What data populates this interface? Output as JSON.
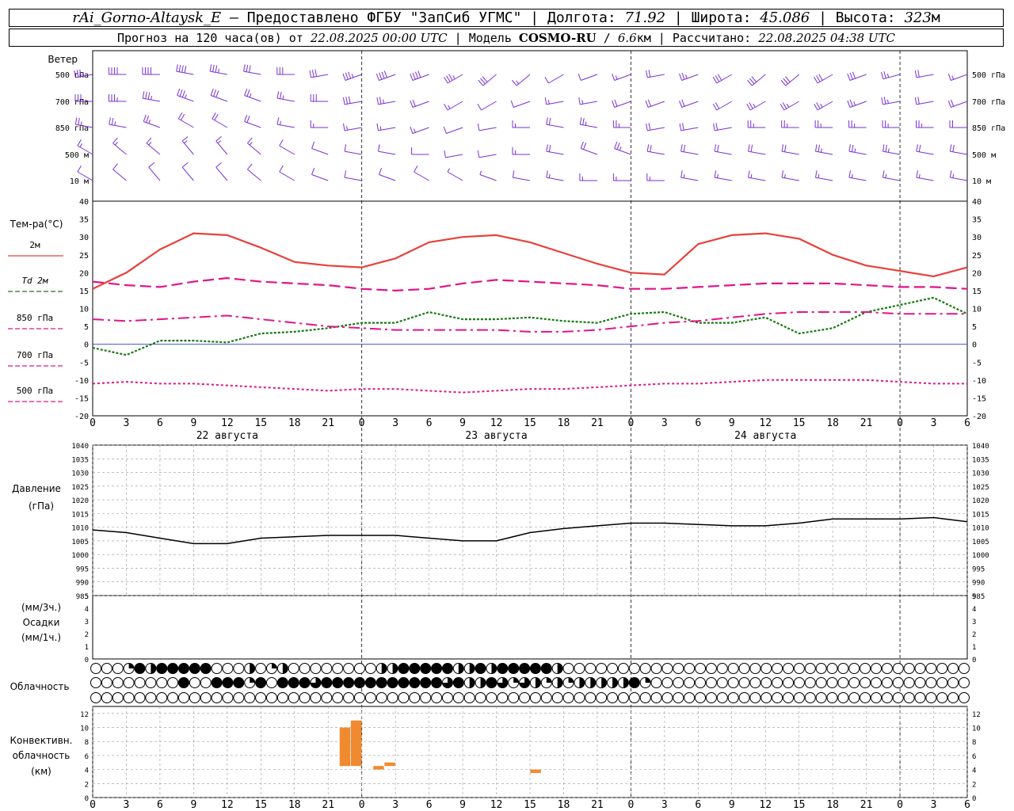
{
  "header": {
    "station": "rAi_Gorno-Altaysk_E",
    "dash": " – ",
    "provider_label": "Предоставлено ФГБУ \"ЗапСиб УГМС\"",
    "lon_label": "Долгота:",
    "lon_value": "71.92",
    "lat_label": "Широта:",
    "lat_value": "45.086",
    "alt_label": "Высота:",
    "alt_value": "323",
    "alt_unit": "м",
    "forecast_label": "Прогноз на 120 часа(ов) от",
    "forecast_time": "22.08.2025 00:00 UTC",
    "model_label": "Модель",
    "model_name": "COSMO-RU",
    "model_res": "6.6",
    "model_res_unit": "км",
    "calc_label": "Рассчитано:",
    "calc_time": "22.08.2025 04:38 UTC"
  },
  "colors": {
    "t2m": "#e8403a",
    "td2m": "#1a7a12",
    "t850": "#e0148a",
    "t700": "#e0148a",
    "t500": "#e0148a",
    "wind": "#7a2fd6",
    "convective": "#f08a30",
    "zero_line": "#2a38d4"
  },
  "panels": {
    "wind": {
      "title": "Ветер",
      "levels": [
        "500 гПа",
        "700 гПа",
        "850 гПа",
        "500 м",
        "10 м"
      ]
    },
    "temp": {
      "title": "Тем-ра(°C)",
      "legend": [
        "2м",
        "Td 2м",
        "850 гПа",
        "700 гПа",
        "500 гПа"
      ]
    },
    "pressure": {
      "title": "Давление",
      "unit": "(гПа)"
    },
    "precip": {
      "unit_top": "(мм/3ч.)",
      "title": "Осадки",
      "unit_bottom": "(мм/1ч.)"
    },
    "cloud": {
      "title": "Облачность"
    },
    "convective": {
      "title_1": "Конвективн.",
      "title_2": "облачность",
      "unit": "(км)"
    }
  },
  "axis": {
    "x_ticks": [
      "0",
      "3",
      "6",
      "9",
      "12",
      "15",
      "18",
      "21",
      "0",
      "3",
      "6",
      "9",
      "12",
      "15",
      "18",
      "21",
      "0",
      "3",
      "6",
      "9",
      "12",
      "15",
      "18",
      "21",
      "0",
      "3",
      "6"
    ],
    "day_labels": [
      "22 августа",
      "23 августа",
      "24 августа"
    ]
  },
  "chart_data": [
    {
      "type": "line",
      "title": "Тем-ра(°C)",
      "x_unit": "hours since 22.08.2025 00:00 UTC",
      "ylim": [
        -20,
        40
      ],
      "yticks": [
        -20,
        -15,
        -10,
        -5,
        0,
        5,
        10,
        15,
        20,
        25,
        30,
        35,
        40
      ],
      "grid": false,
      "series": [
        {
          "name": "2м",
          "x": [
            0,
            3,
            6,
            9,
            12,
            15,
            18,
            21,
            24,
            27,
            30,
            33,
            36,
            39,
            42,
            45,
            48,
            51,
            54,
            57,
            60,
            63,
            66,
            69,
            72,
            75,
            78
          ],
          "values": [
            15.5,
            20,
            26.5,
            31,
            30.5,
            27,
            23,
            22,
            21.5,
            24,
            28.5,
            30,
            30.5,
            28.5,
            25.5,
            22.5,
            20,
            19.5,
            28,
            30.5,
            31,
            29.5,
            25,
            22,
            20.5,
            19,
            21.5
          ]
        },
        {
          "name": "Td 2м",
          "x": [
            0,
            3,
            6,
            9,
            12,
            15,
            18,
            21,
            24,
            27,
            30,
            33,
            36,
            39,
            42,
            45,
            48,
            51,
            54,
            57,
            60,
            63,
            66,
            69,
            72,
            75,
            78
          ],
          "values": [
            -1,
            -3,
            1,
            1,
            0.5,
            3,
            3.5,
            4.5,
            6,
            6,
            9,
            7,
            7,
            7.5,
            6.5,
            6,
            8.5,
            9,
            6,
            6,
            7.5,
            3,
            4.5,
            9,
            11,
            13,
            8.5
          ]
        },
        {
          "name": "850 гПа",
          "x": [
            0,
            3,
            6,
            9,
            12,
            15,
            18,
            21,
            24,
            27,
            30,
            33,
            36,
            39,
            42,
            45,
            48,
            51,
            54,
            57,
            60,
            63,
            66,
            69,
            72,
            75,
            78
          ],
          "values": [
            17.5,
            16.5,
            16,
            17.5,
            18.5,
            17.5,
            17,
            16.5,
            15.5,
            15,
            15.5,
            17,
            18,
            17.5,
            17,
            16.5,
            15.5,
            15.5,
            16,
            16.5,
            17,
            17,
            17,
            16.5,
            16,
            16,
            15.5
          ]
        },
        {
          "name": "700 гПа",
          "x": [
            0,
            3,
            6,
            9,
            12,
            15,
            18,
            21,
            24,
            27,
            30,
            33,
            36,
            39,
            42,
            45,
            48,
            51,
            54,
            57,
            60,
            63,
            66,
            69,
            72,
            75,
            78
          ],
          "values": [
            7,
            6.5,
            7,
            7.5,
            8,
            7,
            6,
            5,
            4.5,
            4,
            4,
            4,
            4,
            3.5,
            3.5,
            4,
            5,
            6,
            6.5,
            7.5,
            8.5,
            9,
            9,
            9,
            8.5,
            8.5,
            8.5
          ]
        },
        {
          "name": "500 гПа",
          "x": [
            0,
            3,
            6,
            9,
            12,
            15,
            18,
            21,
            24,
            27,
            30,
            33,
            36,
            39,
            42,
            45,
            48,
            51,
            54,
            57,
            60,
            63,
            66,
            69,
            72,
            75,
            78
          ],
          "values": [
            -11,
            -10.5,
            -11,
            -11,
            -11.5,
            -12,
            -12.5,
            -13,
            -12.5,
            -12.5,
            -13,
            -13.5,
            -13,
            -12.5,
            -12.5,
            -12,
            -11.5,
            -11,
            -11,
            -10.5,
            -10,
            -10,
            -10,
            -10,
            -10.5,
            -11,
            -11
          ]
        }
      ]
    },
    {
      "type": "line",
      "title": "Давление",
      "ylabel": "(гПа)",
      "x_unit": "hours since 22.08.2025 00:00 UTC",
      "ylim": [
        985,
        1040
      ],
      "yticks": [
        985,
        990,
        995,
        1000,
        1005,
        1010,
        1015,
        1020,
        1025,
        1030,
        1035,
        1040
      ],
      "grid": true,
      "series": [
        {
          "name": "Давление",
          "x": [
            0,
            3,
            6,
            9,
            12,
            15,
            18,
            21,
            24,
            27,
            30,
            33,
            36,
            39,
            42,
            45,
            48,
            51,
            54,
            57,
            60,
            63,
            66,
            69,
            72,
            75,
            78
          ],
          "values": [
            1009,
            1008,
            1006,
            1004,
            1004,
            1006,
            1006.5,
            1007,
            1007,
            1007,
            1006,
            1005,
            1005,
            1008,
            1009.5,
            1010.5,
            1011.5,
            1011.5,
            1011,
            1010.5,
            1010.5,
            1011.5,
            1013,
            1013,
            1013,
            1013.5,
            1012
          ]
        }
      ]
    },
    {
      "type": "bar",
      "title": "Осадки",
      "ylabel": "(мм/3ч.) (мм/1ч.)",
      "ylim": [
        0,
        5
      ],
      "yticks": [
        0,
        1,
        2,
        3,
        4,
        5
      ],
      "x": [],
      "values": []
    },
    {
      "type": "bar",
      "title": "Конвективн. облачность",
      "ylabel": "(км)",
      "x_unit": "hours since 22.08.2025 00:00 UTC",
      "ylim": [
        0,
        13
      ],
      "yticks": [
        0,
        2,
        4,
        6,
        8,
        10,
        12
      ],
      "grid": true,
      "bars": [
        {
          "x": 22.5,
          "base": 4.5,
          "top": 10
        },
        {
          "x": 23.5,
          "base": 4.5,
          "top": 11
        },
        {
          "x": 25.5,
          "base": 4,
          "top": 4.5
        },
        {
          "x": 26.5,
          "base": 4.5,
          "top": 5
        },
        {
          "x": 39.5,
          "base": 3.5,
          "top": 4
        }
      ]
    }
  ],
  "wind_barbs": {
    "500 гПа": {
      "dir": [
        260,
        270,
        270,
        280,
        280,
        280,
        270,
        260,
        250,
        250,
        250,
        240,
        230,
        230,
        240,
        250,
        250,
        260,
        250,
        240,
        230,
        230,
        240,
        250,
        255,
        260,
        250
      ],
      "speed": [
        35,
        40,
        40,
        40,
        35,
        30,
        30,
        30,
        35,
        40,
        40,
        35,
        30,
        15,
        10,
        10,
        15,
        20,
        25,
        30,
        30,
        30,
        30,
        30,
        25,
        20,
        15
      ]
    },
    "700 гПа": {
      "dir": [
        270,
        270,
        280,
        290,
        290,
        290,
        280,
        270,
        260,
        260,
        250,
        240,
        240,
        250,
        260,
        260,
        250,
        250,
        250,
        240,
        240,
        240,
        240,
        250,
        260,
        260,
        250
      ],
      "speed": [
        30,
        35,
        35,
        35,
        30,
        25,
        25,
        30,
        30,
        25,
        20,
        15,
        10,
        10,
        15,
        15,
        20,
        20,
        20,
        20,
        25,
        25,
        25,
        25,
        25,
        20,
        20
      ]
    },
    "850 гПа": {
      "dir": [
        280,
        280,
        290,
        300,
        300,
        290,
        280,
        270,
        260,
        260,
        250,
        250,
        260,
        270,
        280,
        280,
        270,
        260,
        260,
        260,
        270,
        270,
        270,
        270,
        270,
        270,
        270
      ],
      "speed": [
        25,
        25,
        25,
        20,
        20,
        20,
        15,
        15,
        15,
        15,
        15,
        10,
        10,
        15,
        20,
        25,
        25,
        20,
        20,
        20,
        25,
        25,
        25,
        25,
        25,
        25,
        20
      ]
    },
    "500 м": {
      "dir": [
        300,
        310,
        310,
        320,
        320,
        310,
        300,
        290,
        280,
        280,
        270,
        260,
        260,
        270,
        280,
        290,
        290,
        280,
        280,
        280,
        280,
        280,
        280,
        280,
        280,
        280,
        280
      ],
      "speed": [
        15,
        15,
        15,
        15,
        15,
        15,
        10,
        10,
        10,
        10,
        10,
        10,
        10,
        15,
        20,
        20,
        25,
        20,
        20,
        20,
        20,
        20,
        25,
        25,
        25,
        20,
        20
      ]
    },
    "10 м": {
      "dir": [
        300,
        310,
        320,
        320,
        320,
        310,
        300,
        290,
        280,
        290,
        300,
        300,
        290,
        280,
        280,
        270,
        270,
        270,
        280,
        280,
        280,
        280,
        280,
        280,
        280,
        280,
        280
      ],
      "speed": [
        10,
        10,
        10,
        10,
        10,
        10,
        10,
        10,
        10,
        10,
        10,
        5,
        5,
        10,
        15,
        15,
        15,
        15,
        15,
        15,
        15,
        15,
        15,
        15,
        15,
        15,
        15
      ]
    }
  },
  "cloud_cover": {
    "note": "0=clear,1=quarter,2=half,3=three-quarter,4=overcast",
    "high": [
      0,
      0,
      0,
      1,
      4,
      2,
      4,
      4,
      4,
      4,
      4,
      0,
      0,
      0,
      2,
      0,
      1,
      2,
      0,
      0,
      0,
      0,
      0,
      0,
      0,
      0,
      2,
      2,
      4,
      4,
      4,
      4,
      4,
      2,
      2,
      4,
      2,
      4,
      4,
      4,
      4,
      4,
      2,
      0,
      0,
      0,
      0,
      0,
      0,
      0,
      0,
      0,
      0,
      0,
      0,
      0,
      0,
      0,
      0,
      0,
      0,
      0,
      0,
      0,
      0,
      0,
      0,
      0,
      0,
      0,
      0,
      0,
      0,
      0,
      0,
      0,
      0,
      0,
      0,
      0
    ],
    "middle": [
      0,
      0,
      0,
      0,
      0,
      0,
      0,
      0,
      4,
      0,
      0,
      4,
      4,
      4,
      1,
      4,
      0,
      4,
      4,
      4,
      3,
      4,
      4,
      4,
      4,
      4,
      4,
      4,
      4,
      4,
      4,
      4,
      3,
      4,
      2,
      2,
      4,
      3,
      1,
      3,
      2,
      1,
      2,
      1,
      2,
      2,
      2,
      2,
      2,
      4,
      1,
      0,
      0,
      0,
      0,
      0,
      0,
      0,
      0,
      0,
      0,
      0,
      0,
      0,
      0,
      0,
      0,
      0,
      0,
      0,
      0,
      0,
      0,
      0,
      0,
      0,
      0,
      0,
      0,
      0
    ],
    "low": [
      0,
      0,
      0,
      0,
      0,
      0,
      0,
      0,
      0,
      0,
      0,
      0,
      0,
      0,
      0,
      0,
      0,
      0,
      0,
      0,
      0,
      0,
      0,
      0,
      0,
      0,
      0,
      0,
      0,
      0,
      0,
      0,
      0,
      0,
      0,
      0,
      0,
      0,
      0,
      0,
      0,
      0,
      0,
      0,
      0,
      0,
      0,
      0,
      0,
      0,
      0,
      0,
      0,
      0,
      0,
      0,
      0,
      0,
      0,
      0,
      0,
      0,
      0,
      0,
      0,
      0,
      0,
      0,
      0,
      0,
      0,
      0,
      0,
      0,
      0,
      0,
      0,
      0,
      0,
      0
    ]
  }
}
